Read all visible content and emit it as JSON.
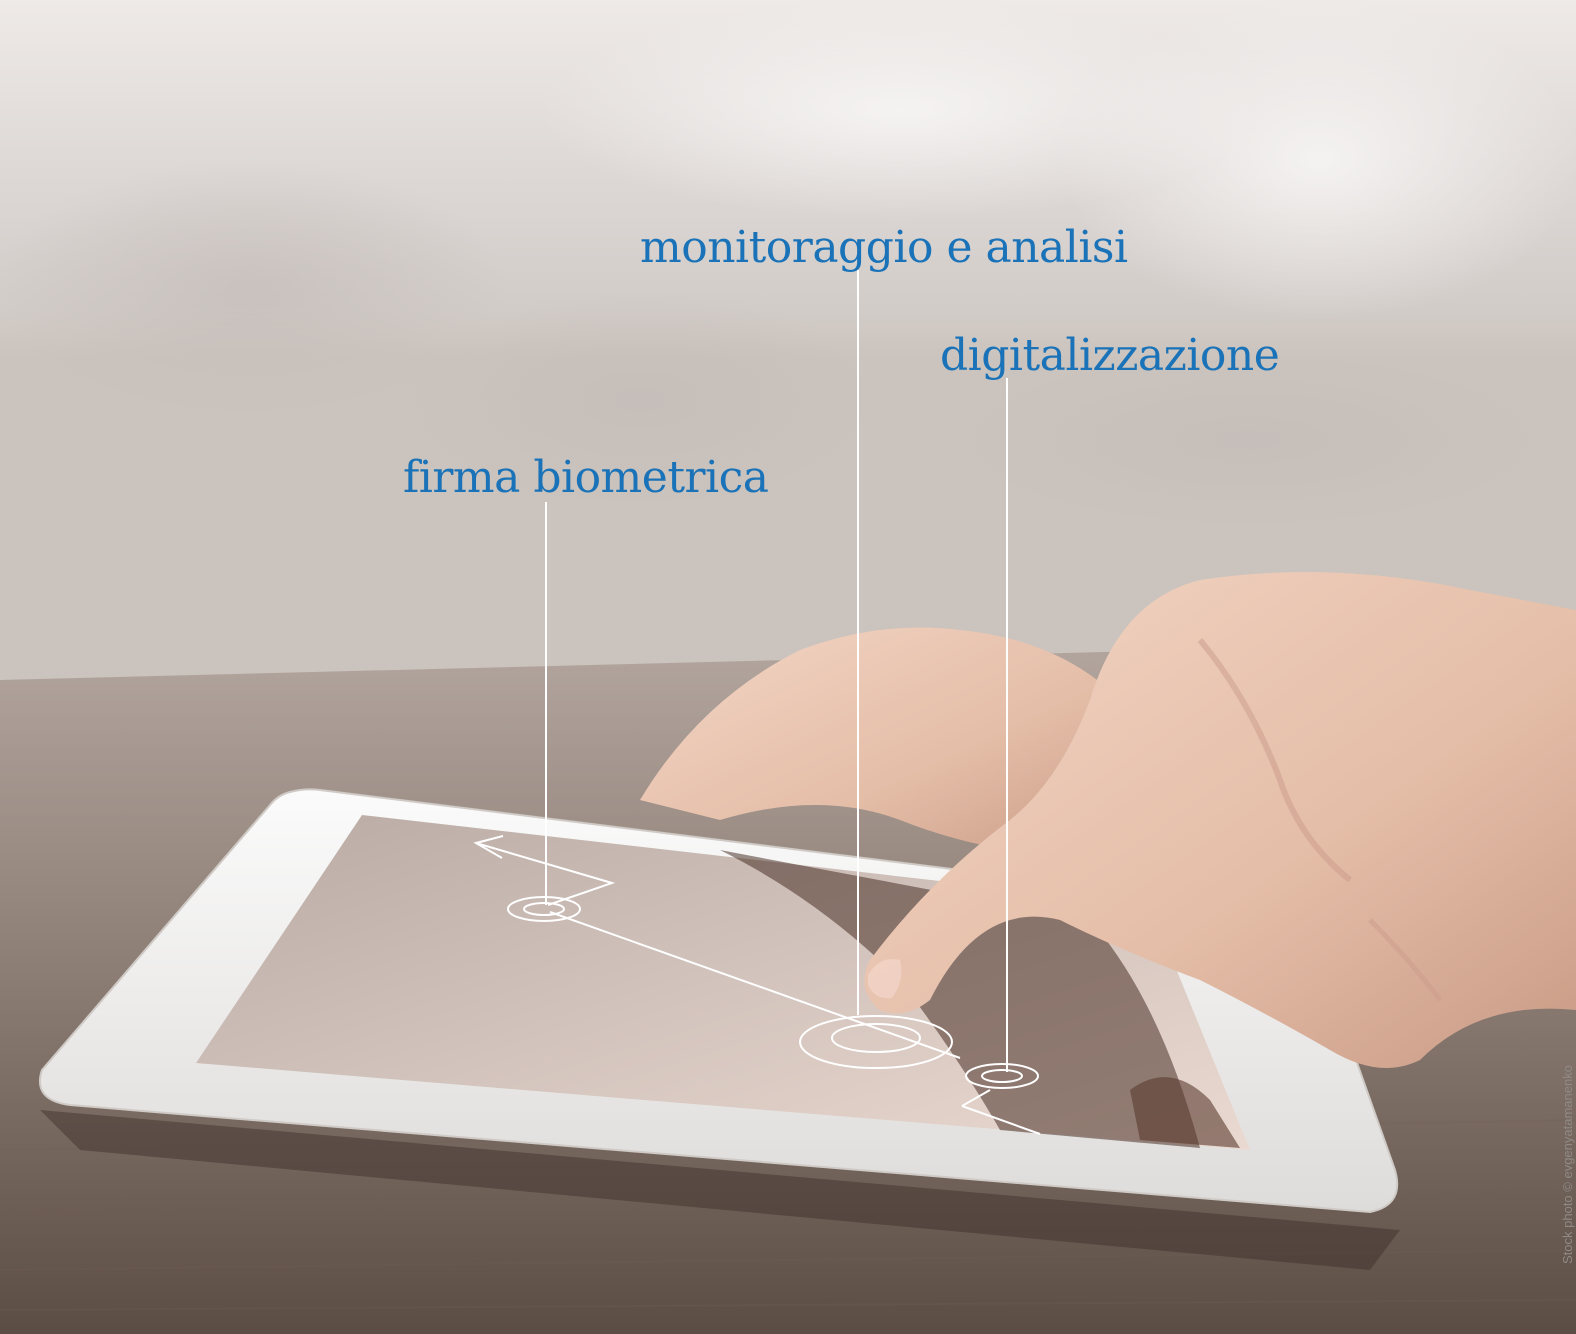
{
  "labels": {
    "monitoraggio": "monitoraggio e analisi",
    "digitalizzazione": "digitalizzazione",
    "firma": "firma biometrica"
  },
  "credit": "Stock photo © evgenyatamanenko",
  "colors": {
    "label": "#1a73b8",
    "lines": "#ffffff",
    "table": "#8c7e76",
    "tablet_frame": "#f3f2f1",
    "screen": "#c9b8b0",
    "skin": "#e7c2ad"
  }
}
